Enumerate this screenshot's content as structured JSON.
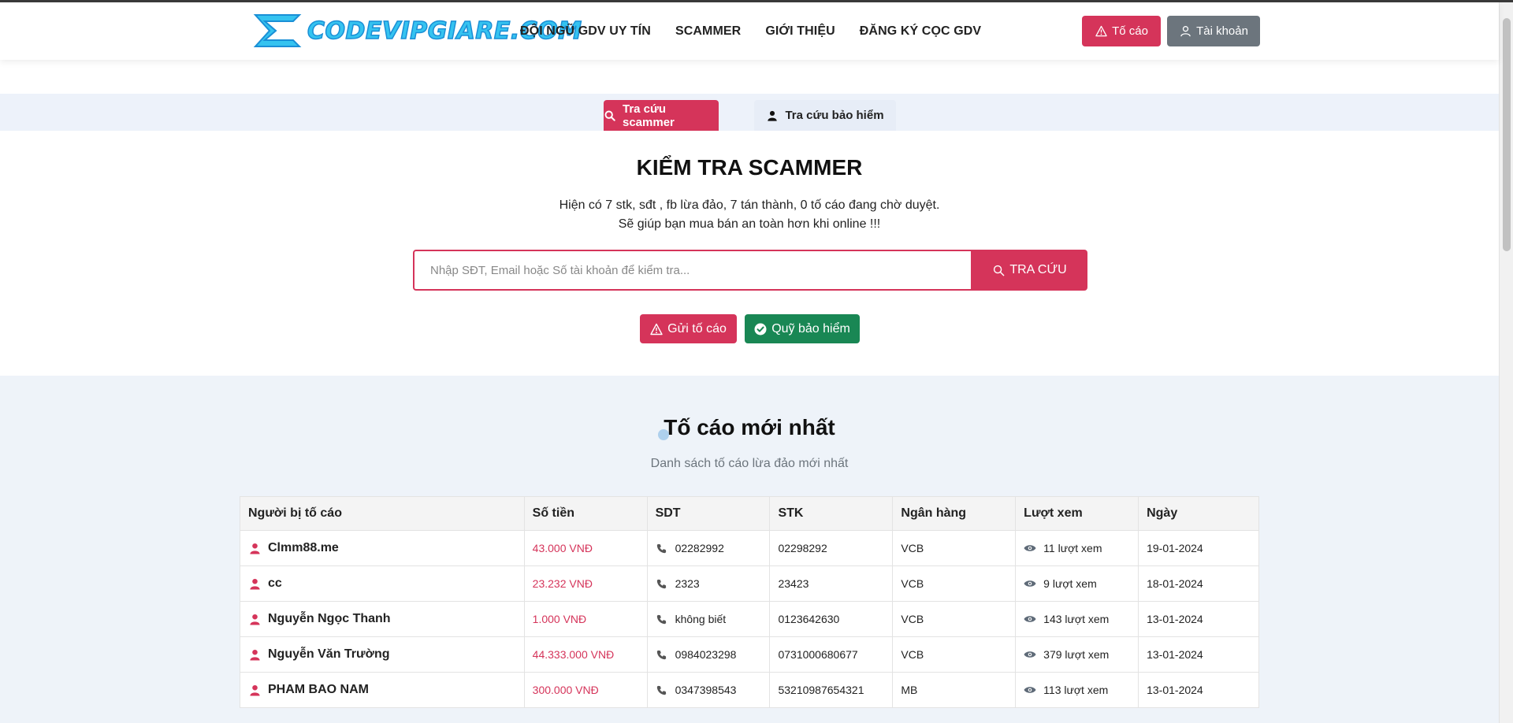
{
  "header": {
    "logo_text": "CODEVIPGIARE.COM",
    "nav": [
      "ĐỘI NGŨ GDV UY TÍN",
      "SCAMMER",
      "GIỚI THIỆU",
      "ĐĂNG KÝ CỌC GDV"
    ],
    "report_label": "Tố cáo",
    "account_label": "Tài khoản"
  },
  "tabs": {
    "scam_label": "Tra cứu scammer",
    "insurance_label": "Tra cứu bảo hiểm"
  },
  "check": {
    "title": "KIỂM TRA SCAMMER",
    "stats_line": "Hiện có 7 stk, sđt , fb lừa đảo, 7 tán thành, 0 tố cáo đang chờ duyệt.",
    "tagline": "Sẽ giúp bạn mua bán an toàn hơn khi online !!!",
    "search_placeholder": "Nhập SĐT, Email hoặc Số tài khoản để kiểm tra...",
    "search_button": "TRA CỨU",
    "send_report": "Gửi tố cáo",
    "insurance_fund": "Quỹ bảo hiểm"
  },
  "latest": {
    "title": "Tố cáo mới nhất",
    "subtitle": "Danh sách tố cáo lừa đảo mới nhất",
    "columns": [
      "Người bị tố cáo",
      "Số tiền",
      "SDT",
      "STK",
      "Ngân hàng",
      "Lượt xem",
      "Ngày"
    ],
    "rows": [
      {
        "name": "Clmm88.me",
        "amount": "43.000 VNĐ",
        "phone": "02282992",
        "account": "02298292",
        "bank": "VCB",
        "views": "11 lượt xem",
        "date": "19-01-2024"
      },
      {
        "name": "cc",
        "amount": "23.232 VNĐ",
        "phone": "2323",
        "account": "23423",
        "bank": "VCB",
        "views": "9 lượt xem",
        "date": "18-01-2024"
      },
      {
        "name": "Nguyễn Ngọc Thanh",
        "amount": "1.000 VNĐ",
        "phone": "không biết",
        "account": "0123642630",
        "bank": "VCB",
        "views": "143 lượt xem",
        "date": "13-01-2024"
      },
      {
        "name": "Nguyễn Văn Trường",
        "amount": "44.333.000 VNĐ",
        "phone": "0984023298",
        "account": "0731000680677",
        "bank": "VCB",
        "views": "379 lượt xem",
        "date": "13-01-2024"
      },
      {
        "name": "PHAM BAO NAM",
        "amount": "300.000 VNĐ",
        "phone": "0347398543",
        "account": "53210987654321",
        "bank": "MB",
        "views": "113 lượt xem",
        "date": "13-01-2024"
      }
    ]
  },
  "colors": {
    "accent": "#d5345a",
    "success": "#198754",
    "secondary": "#6c757d",
    "logo": "#35c3f0"
  }
}
